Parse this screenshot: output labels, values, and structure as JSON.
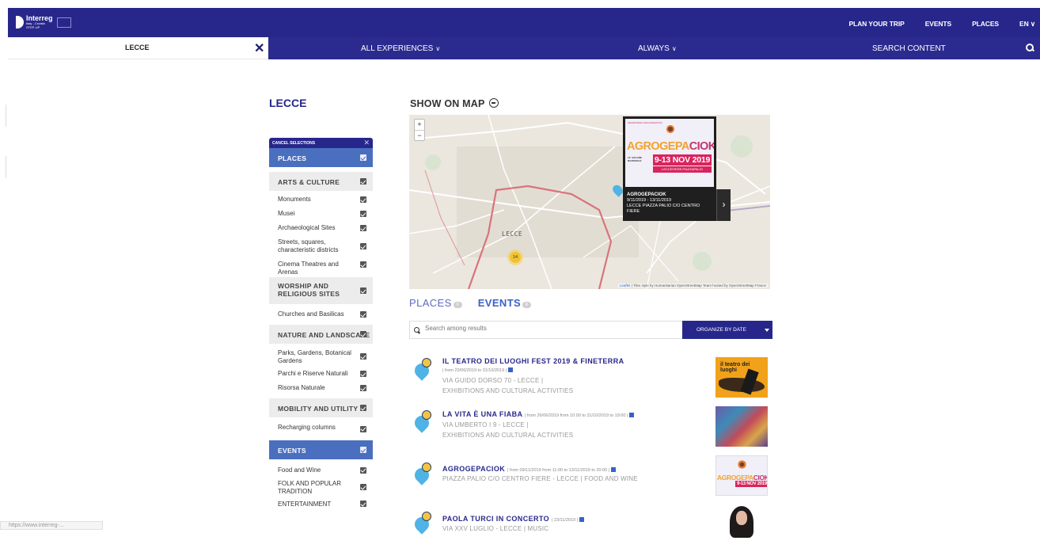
{
  "brand": {
    "name": "Interreg",
    "sub1": "Italy - Croatia",
    "sub2": "STEP-UP"
  },
  "topnav": [
    {
      "label": "PLAN YOUR TRIP"
    },
    {
      "label": "EVENTS"
    },
    {
      "label": "PLACES"
    },
    {
      "label": "EN ∨"
    }
  ],
  "subnav": {
    "location": "LECCE",
    "close": "✕",
    "experiences": "ALL EXPERIENCES",
    "when": "ALWAYS",
    "search": "SEARCH CONTENT",
    "chevron": "∨"
  },
  "page": {
    "title": "LECCE",
    "map_title": "SHOW ON MAP"
  },
  "sidebar": {
    "cancel": "CANCEL SELECTIONS",
    "cancel_x": "✕",
    "groups": [
      {
        "label": "PLACES",
        "style": "blue",
        "items": []
      },
      {
        "label": "ARTS & CULTURE",
        "style": "gray",
        "items": [
          "Monuments",
          "Musei",
          "Archaeological Sites",
          "Streets, squares, characteristic districts",
          "Cinema Theatres and Arenas"
        ]
      },
      {
        "label": "WORSHIP AND RELIGIOUS SITES",
        "style": "gray",
        "items": [
          "Churches and Basilicas"
        ]
      },
      {
        "label": "NATURE AND LANDSCAPE",
        "style": "gray",
        "items": [
          "Parks, Gardens, Botanical Gardens",
          "Parchi e Riserve Naturali",
          "Risorsa Naturale"
        ]
      },
      {
        "label": "MOBILITY AND UTILITY",
        "style": "gray",
        "items": [
          "Recharging columns"
        ]
      },
      {
        "label": "EVENTS",
        "style": "blue",
        "items": [
          "Food and Wine",
          "FOLK AND POPULAR TRADITION",
          "ENTERTAINMENT"
        ]
      }
    ]
  },
  "map": {
    "zoom_in": "+",
    "zoom_out": "−",
    "city": "LECCE",
    "cluster": "14",
    "popup": {
      "poster_top": "SEGRETERIA ORGANIZZATIVA",
      "brand_a": "AGROGEPA",
      "brand_b": "CIOK",
      "info": "14° SALONE NAZIONALE",
      "dates": "9-13 NOV 2019",
      "web": "LECCEFIERE.PIAZZAPALIO",
      "title": "AGROGEPACIOK",
      "range": "9/11/2019 - 13/11/2019",
      "place": "LECCE PIAZZA PALIO C/O CENTRO FIERE",
      "next": "›"
    },
    "attribution_a": "Leaflet",
    "attribution_b": " | Tiles style by Humanitarian OpenStreetMap Team hosted by OpenStreetMap France"
  },
  "tabs": [
    {
      "label": "PLACES",
      "count": "0",
      "active": false
    },
    {
      "label": "EVENTS",
      "count": "0",
      "active": true
    }
  ],
  "search": {
    "placeholder": "Search among results",
    "sort": "ORGANIZE BY DATE"
  },
  "results": [
    {
      "title": "IL TEATRO DEI LUOGHI FEST 2019 & FINETERRA",
      "dates": "| from 23/06/2019 to 31/10/2019 |",
      "line1": "VIA GUIDO DORSO 70 - LECCE |",
      "line2": "EXHIBITIONS AND CULTURAL ACTIVITIES",
      "thumb_text": "il teatro dei luoghi"
    },
    {
      "title": "LA VITA È UNA FIABA",
      "dates": "| from 26/06/2019 from 10:00 to 31/10/2019 to 19:00 |",
      "line1": "VIA UMBERTO I 9 - LECCE |",
      "line2": "EXHIBITIONS AND CULTURAL ACTIVITIES"
    },
    {
      "title": "AGROGEPACIOK",
      "dates": "| from 09/11/2019 from 11:00 to 13/11/2019 to 20:00 |",
      "line1": "PIAZZA PALIO C/O CENTRO FIERE - LECCE | FOOD AND WINE",
      "thumb_a": "AGROGEPA",
      "thumb_b": "CIOK",
      "thumb_dates": "9-13 NOV 2019"
    },
    {
      "title": "PAOLA TURCI IN CONCERTO",
      "dates": "| 23/11/2019 |",
      "line1": "VIA XXV LUGLIO - LECCE | MUSIC"
    }
  ],
  "status": "https://www.interreg-..."
}
